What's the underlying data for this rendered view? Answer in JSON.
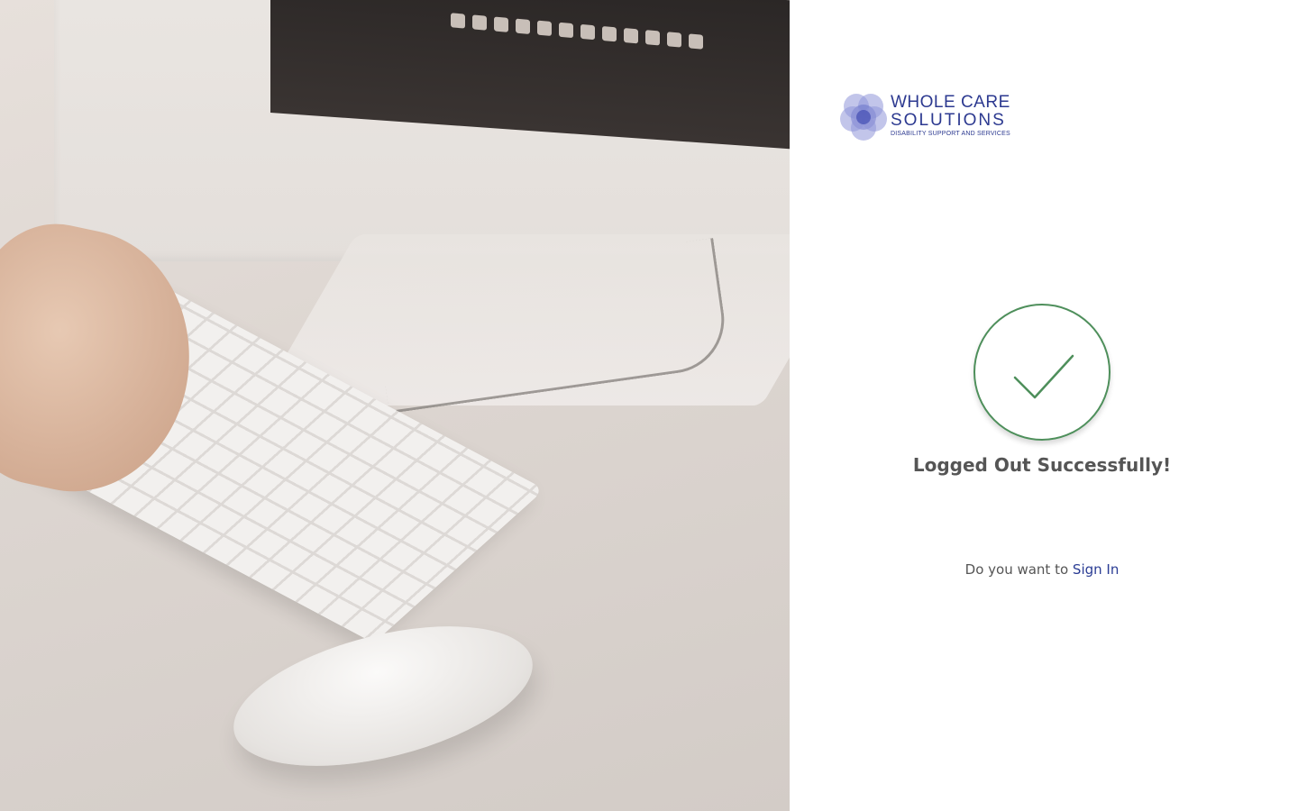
{
  "brand": {
    "name_line1": "WHOLE CARE",
    "name_line2": "SOLUTIONS",
    "tagline": "DISABILITY SUPPORT AND SERVICES",
    "color": "#2c3990"
  },
  "hero": {
    "image_alt": "desk-with-computer-keyboard-and-mouse"
  },
  "status": {
    "icon": "check-icon",
    "title": "Logged Out Successfully!",
    "success_color": "#4e8f5b"
  },
  "signin_prompt": {
    "text": "Do you want to ",
    "link_label": "Sign In",
    "link_color": "#2a3c94"
  }
}
